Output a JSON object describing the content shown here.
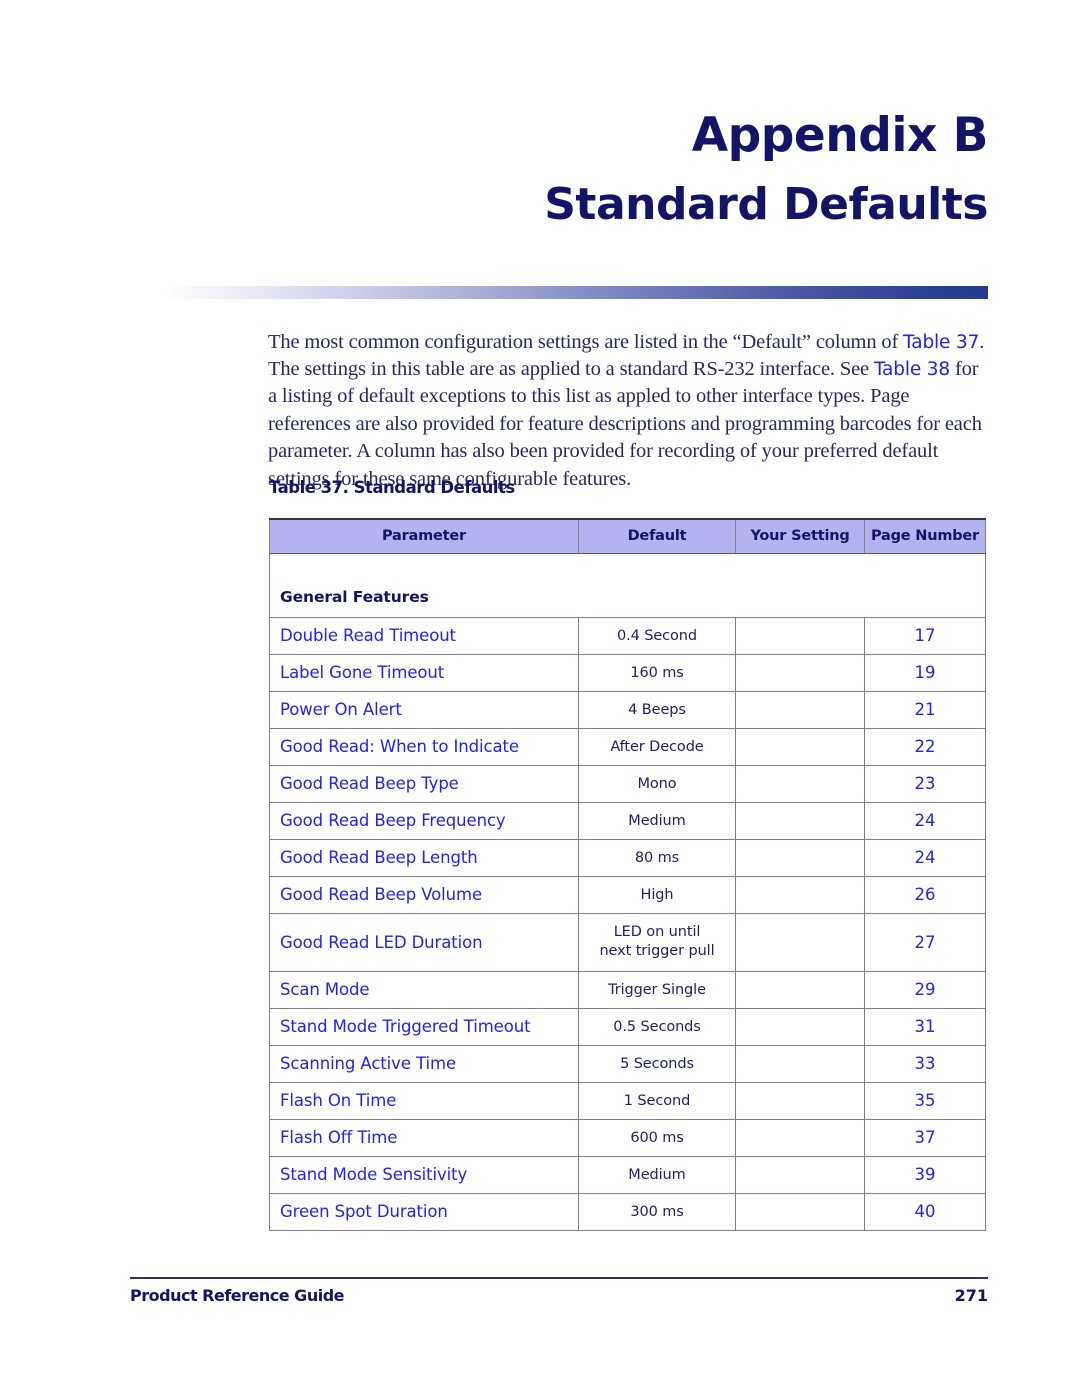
{
  "document": {
    "appendix_label": "Appendix B",
    "appendix_title": "Standard Defaults"
  },
  "intro": {
    "s1": "The most common configuration settings are listed in the “Default” column of ",
    "link1": "Table 37",
    "s2": ". The settings in this table are as applied to a standard RS-232 interface. See ",
    "link2": "Table 38",
    "s3": " for a listing of default exceptions to this list as appled to other interface types. Page references are also provided for feature descriptions and programming barcodes for each parameter. A column has also been provided for recording of your preferred default settings for these same configurable features."
  },
  "table": {
    "caption": "Table 37. Standard Defaults",
    "headers": {
      "parameter": "Parameter",
      "default": "Default",
      "your_setting": "Your Setting",
      "page_number": "Page Number"
    },
    "section_label": "General Features",
    "rows": [
      {
        "parameter": "Double Read Timeout",
        "default": "0.4 Second",
        "your_setting": "",
        "page": "17"
      },
      {
        "parameter": "Label Gone Timeout",
        "default": "160 ms",
        "your_setting": "",
        "page": "19"
      },
      {
        "parameter": "Power On Alert",
        "default": "4 Beeps",
        "your_setting": "",
        "page": "21"
      },
      {
        "parameter": "Good Read: When to Indicate",
        "default": "After Decode",
        "your_setting": "",
        "page": "22"
      },
      {
        "parameter": "Good Read Beep Type",
        "default": "Mono",
        "your_setting": "",
        "page": "23"
      },
      {
        "parameter": "Good Read Beep Frequency",
        "default": "Medium",
        "your_setting": "",
        "page": "24"
      },
      {
        "parameter": "Good Read Beep Length",
        "default": "80 ms",
        "your_setting": "",
        "page": "24"
      },
      {
        "parameter": "Good Read Beep Volume",
        "default": "High",
        "your_setting": "",
        "page": "26"
      },
      {
        "parameter": "Good Read LED Duration",
        "default": "LED on until\nnext trigger pull",
        "your_setting": "",
        "page": "27",
        "tall": true
      },
      {
        "parameter": "Scan Mode",
        "default": "Trigger Single",
        "your_setting": "",
        "page": "29"
      },
      {
        "parameter": "Stand Mode Triggered Timeout",
        "default": "0.5 Seconds",
        "your_setting": "",
        "page": "31"
      },
      {
        "parameter": "Scanning Active Time",
        "default": "5 Seconds",
        "your_setting": "",
        "page": "33"
      },
      {
        "parameter": "Flash On Time",
        "default": "1 Second",
        "your_setting": "",
        "page": "35"
      },
      {
        "parameter": "Flash Off Time",
        "default": "600 ms",
        "your_setting": "",
        "page": "37"
      },
      {
        "parameter": "Stand Mode Sensitivity",
        "default": "Medium",
        "your_setting": "",
        "page": "39"
      },
      {
        "parameter": "Green Spot Duration",
        "default": "300 ms",
        "your_setting": "",
        "page": "40"
      }
    ]
  },
  "footer": {
    "left": "Product Reference Guide",
    "page_number": "271"
  },
  "colors": {
    "heading_navy": "#141466",
    "link_blue": "#2222ee",
    "table_header_bg": "#b3b3f2",
    "body_text": "#272763",
    "rule_blue": "#27398e"
  }
}
